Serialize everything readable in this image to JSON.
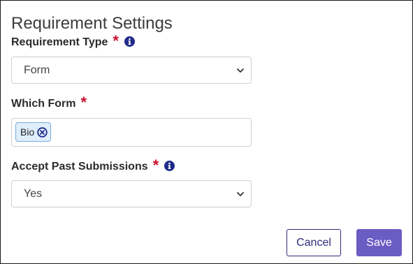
{
  "dialog": {
    "title": "Requirement Settings"
  },
  "fields": {
    "requirement_type": {
      "label": "Requirement Type",
      "required_mark": "*",
      "value": "Form"
    },
    "which_form": {
      "label": "Which Form",
      "required_mark": "*",
      "selected": [
        "Bio"
      ]
    },
    "accept_past_submissions": {
      "label": "Accept Past Submissions",
      "required_mark": "*",
      "value": "Yes"
    }
  },
  "actions": {
    "cancel_label": "Cancel",
    "save_label": "Save"
  },
  "icons": {
    "info": "info-circle-icon",
    "chevron": "chevron-down-icon",
    "remove": "remove-circle-icon"
  },
  "colors": {
    "required": "#c8102e",
    "info_icon": "#1f2a8a",
    "chip_bg": "#deeefb",
    "chip_border": "#7aaedc",
    "cancel_border": "#2f2c7a",
    "save_bg": "#6b5cc4"
  }
}
